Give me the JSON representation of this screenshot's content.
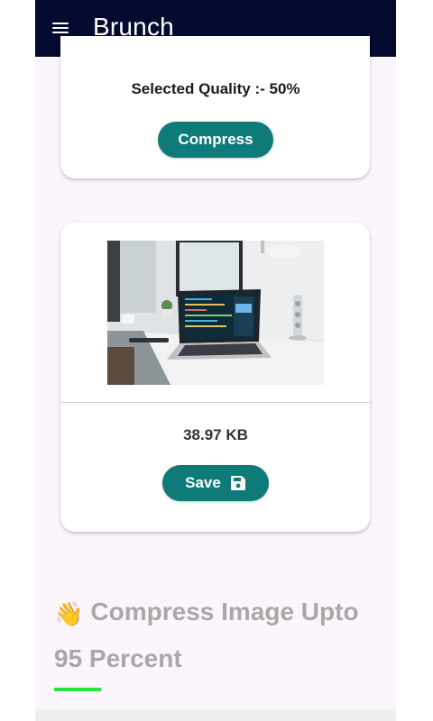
{
  "appbar": {
    "title": "Brunch",
    "menu_icon": "hamburger-menu-icon"
  },
  "quality_card": {
    "quality_text": "Selected Quality :- 50%",
    "compress_label": "Compress"
  },
  "image_card": {
    "image": "laptop-desk-photo",
    "size_text": "38.97 KB",
    "save_label": "Save",
    "save_icon": "floppy-disk-icon"
  },
  "promo": {
    "emoji": "👋",
    "line1": "Compress Image Upto",
    "line2": "95 Percent"
  },
  "colors": {
    "appbar": "#050a30",
    "button": "#0e7b78",
    "background": "#fcf6fc",
    "accent_underline": "#23e83a"
  }
}
